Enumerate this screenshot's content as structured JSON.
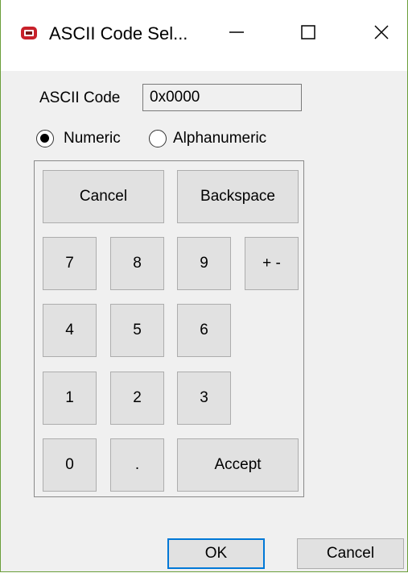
{
  "window": {
    "title": "ASCII Code Sel...",
    "icon": "red-app-icon",
    "controls": {
      "minimize": "minimize-icon",
      "maximize": "maximize-icon",
      "close": "close-icon"
    }
  },
  "ascii": {
    "label": "ASCII Code",
    "value": "0x0000"
  },
  "mode": {
    "numeric_label": "Numeric",
    "alphanumeric_label": "Alphanumeric",
    "selected": "Numeric"
  },
  "keypad": {
    "cancel": "Cancel",
    "backspace": "Backspace",
    "k7": "7",
    "k8": "8",
    "k9": "9",
    "plusminus": "+ -",
    "k4": "4",
    "k5": "5",
    "k6": "6",
    "k1": "1",
    "k2": "2",
    "k3": "3",
    "k0": "0",
    "dot": ".",
    "accept": "Accept"
  },
  "footer": {
    "ok": "OK",
    "cancel": "Cancel"
  },
  "colors": {
    "accent": "#0078d7",
    "window_border": "#6b9e3a",
    "face": "#f0f0f0",
    "button": "#e1e1e1"
  }
}
